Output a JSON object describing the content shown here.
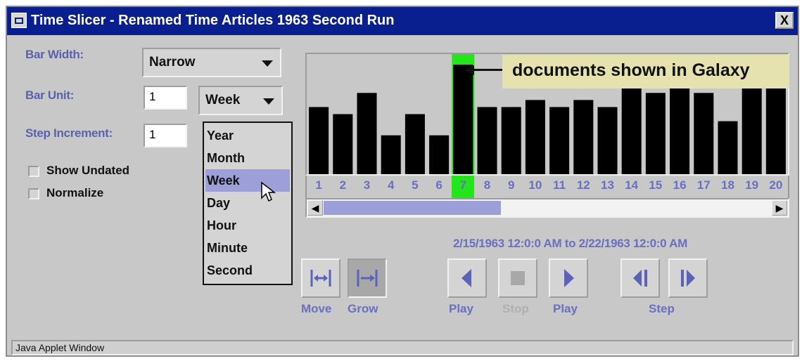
{
  "window": {
    "title": "Time Slicer - Renamed Time Articles 1963 Second Run",
    "close_label": "X",
    "status": "Java Applet Window"
  },
  "controls": {
    "bar_width_label": "Bar Width:",
    "bar_width_value": "Narrow",
    "bar_unit_label": "Bar Unit:",
    "bar_unit_count": "1",
    "bar_unit_value": "Week",
    "step_increment_label": "Step Increment:",
    "step_increment_value": "1",
    "unit_options": [
      "Year",
      "Month",
      "Week",
      "Day",
      "Hour",
      "Minute",
      "Second"
    ],
    "selected_option": "Week",
    "show_undated_label": "Show Undated",
    "show_undated_checked": false,
    "normalize_label": "Normalize",
    "normalize_checked": false
  },
  "chart_data": {
    "type": "bar",
    "categories": [
      "1",
      "2",
      "3",
      "4",
      "5",
      "6",
      "7",
      "8",
      "9",
      "10",
      "11",
      "12",
      "13",
      "14",
      "15",
      "16",
      "17",
      "18",
      "19",
      "20"
    ],
    "values": [
      9.5,
      8.5,
      11.5,
      5.5,
      8.5,
      5.5,
      15.5,
      9.5,
      9.5,
      10.5,
      9.5,
      10.5,
      9.5,
      13.5,
      11.5,
      12.5,
      11.5,
      7.5,
      12.5,
      12.5
    ],
    "highlight_index": 6,
    "highlight_color": "#22e61a",
    "bar_color": "#000000",
    "annotation": "documents shown in Galaxy",
    "ylim": [
      0,
      17
    ]
  },
  "scrollbar": {
    "position_fraction": 0.0,
    "visible_fraction": 0.39
  },
  "date_range": "2/15/1963 12:0:0 AM to 2/22/1963 12:0:0 AM",
  "buttons": {
    "move_label": "Move",
    "grow_label": "Grow",
    "play_back_label": "Play",
    "stop_label": "Stop",
    "play_forward_label": "Play",
    "step_label": "Step"
  },
  "colors": {
    "title_bar": "#0a1f8f",
    "accent_text": "#6a6fbf",
    "selection": "#9d9fd8"
  }
}
